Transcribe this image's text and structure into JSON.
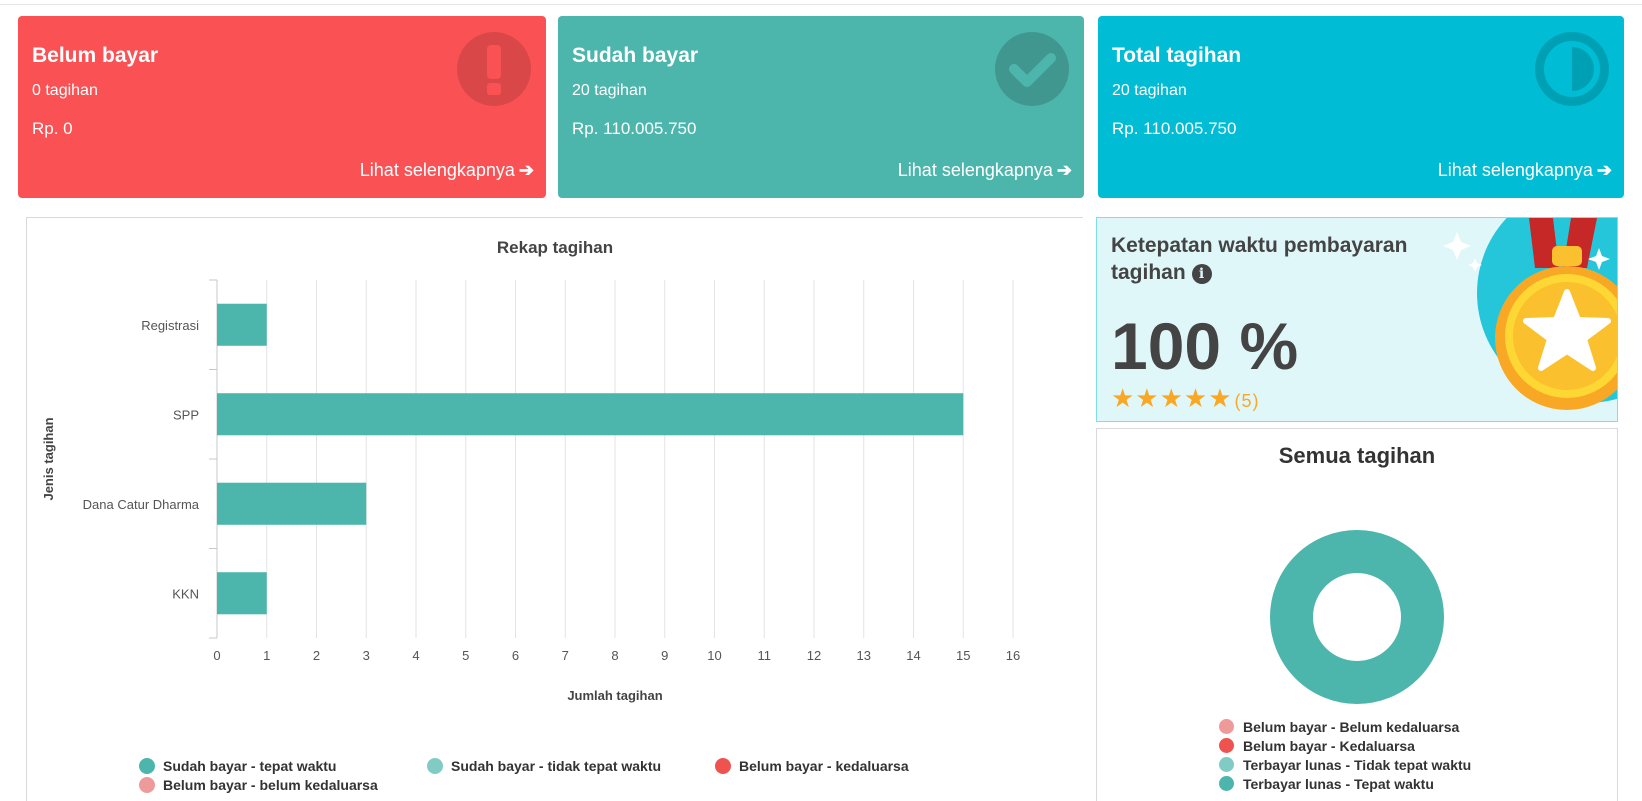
{
  "cards": [
    {
      "title": "Belum bayar",
      "count": "0 tagihan",
      "amount": "Rp. 0",
      "link": "Lihat selengkapnya",
      "icon": "exclamation-icon",
      "color": "#fa5254"
    },
    {
      "title": "Sudah bayar",
      "count": "20 tagihan",
      "amount": "Rp. 110.005.750",
      "link": "Lihat selengkapnya",
      "icon": "check-circle-icon",
      "color": "#4db6ac"
    },
    {
      "title": "Total tagihan",
      "count": "20 tagihan",
      "amount": "Rp. 110.005.750",
      "link": "Lihat selengkapnya",
      "icon": "half-circle-icon",
      "color": "#00bcd4"
    }
  ],
  "rekap": {
    "legend": [
      {
        "label": "Sudah bayar - tepat waktu",
        "color": "#4db6ac"
      },
      {
        "label": "Sudah bayar - tidak tepat waktu",
        "color": "#80cbc4"
      },
      {
        "label": "Belum bayar - kedaluarsa",
        "color": "#ef5350"
      },
      {
        "label": "Belum bayar - belum kedaluarsa",
        "color": "#ef9a9a"
      }
    ]
  },
  "chart_data": [
    {
      "type": "bar",
      "orientation": "horizontal",
      "title": "Rekap tagihan",
      "xlabel": "Jumlah tagihan",
      "ylabel": "Jenis tagihan",
      "categories": [
        "Registrasi",
        "SPP",
        "Dana Catur Dharma",
        "KKN"
      ],
      "series": [
        {
          "name": "Sudah bayar - tepat waktu",
          "values": [
            1,
            15,
            3,
            1
          ],
          "color": "#4db6ac"
        },
        {
          "name": "Sudah bayar - tidak tepat waktu",
          "values": [
            0,
            0,
            0,
            0
          ],
          "color": "#80cbc4"
        },
        {
          "name": "Belum bayar - kedaluarsa",
          "values": [
            0,
            0,
            0,
            0
          ],
          "color": "#ef5350"
        },
        {
          "name": "Belum bayar - belum kedaluarsa",
          "values": [
            0,
            0,
            0,
            0
          ],
          "color": "#ef9a9a"
        }
      ],
      "xlim": [
        0,
        16
      ],
      "xticks": [
        "0",
        "1",
        "2",
        "3",
        "4",
        "5",
        "6",
        "7",
        "8",
        "9",
        "10",
        "11",
        "12",
        "13",
        "14",
        "15",
        "16"
      ],
      "grid": true,
      "legend_position": "bottom"
    },
    {
      "type": "pie",
      "variant": "donut",
      "title": "Semua tagihan",
      "labels": [
        "Belum bayar - Belum kedaluarsa",
        "Belum bayar - Kedaluarsa",
        "Terbayar lunas - Tidak tepat waktu",
        "Terbayar lunas - Tepat waktu"
      ],
      "values": [
        0,
        0,
        0,
        20
      ],
      "colors": [
        "#ef9a9a",
        "#ef5350",
        "#80cbc4",
        "#4db6ac"
      ],
      "legend_position": "bottom"
    }
  ],
  "ketepatan": {
    "title": "Ketepatan waktu pembayaran tagihan",
    "info_icon": "info-icon",
    "percent": "100 %",
    "rating": 5,
    "rating_label": "(5)",
    "stars": "★★★★★"
  }
}
